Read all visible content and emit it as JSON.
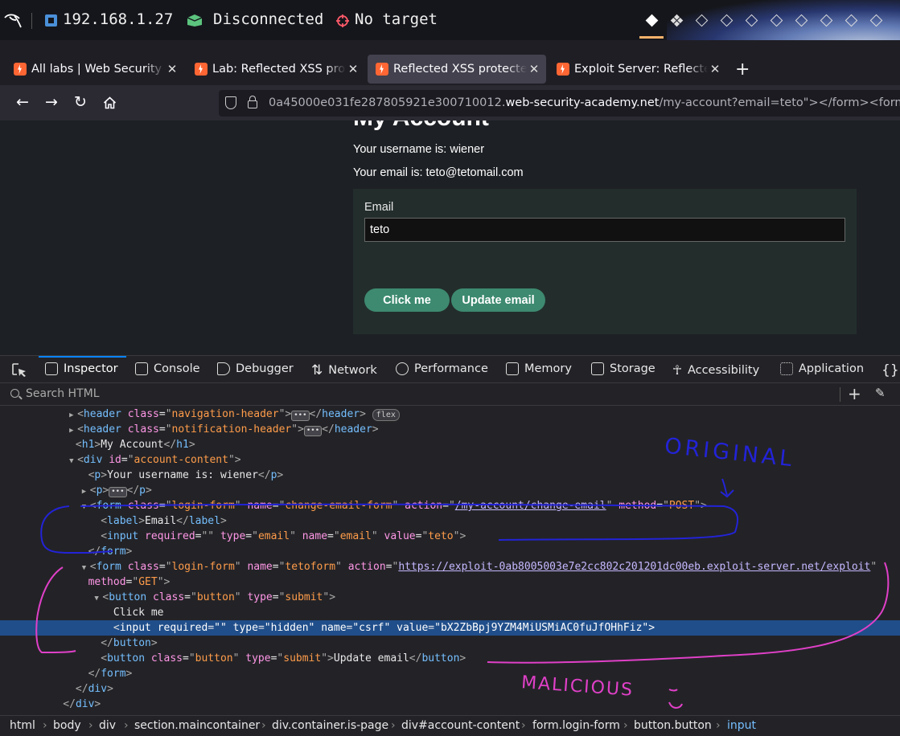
{
  "topbar": {
    "ip": "192.168.1.27",
    "status": "Disconnected",
    "target": "No target"
  },
  "tabs": [
    {
      "title": "All labs | Web Security Academy",
      "active": false
    },
    {
      "title": "Lab: Reflected XSS protected by CSP",
      "active": false
    },
    {
      "title": "Reflected XSS protected by very strict CSP",
      "active": true
    },
    {
      "title": "Exploit Server: Reflected XSS",
      "active": false
    }
  ],
  "address": {
    "prefix": "0a45000e031fe287805921e300710012.",
    "host": "web-security-academy.net",
    "path": "/my-account?email=teto\"></form><form class"
  },
  "page": {
    "heading": "My Account",
    "username_line": "Your username is: wiener",
    "email_line": "Your email is: teto@tetomail.com",
    "email_label": "Email",
    "email_value": "teto",
    "click_me": "Click me",
    "update_email": "Update email"
  },
  "devtools": {
    "tabs": [
      "Inspector",
      "Console",
      "Debugger",
      "Network",
      "Performance",
      "Memory",
      "Storage",
      "Accessibility",
      "Application"
    ],
    "search_placeholder": "Search HTML",
    "breadcrumbs": [
      "html",
      "body",
      "div",
      "section.maincontainer",
      "div.container.is-page",
      "div#account-content",
      "form.login-form",
      "button.button",
      "input"
    ]
  },
  "annotations": {
    "original": "ORIGINAL",
    "malicious": "MALICIOUS"
  }
}
